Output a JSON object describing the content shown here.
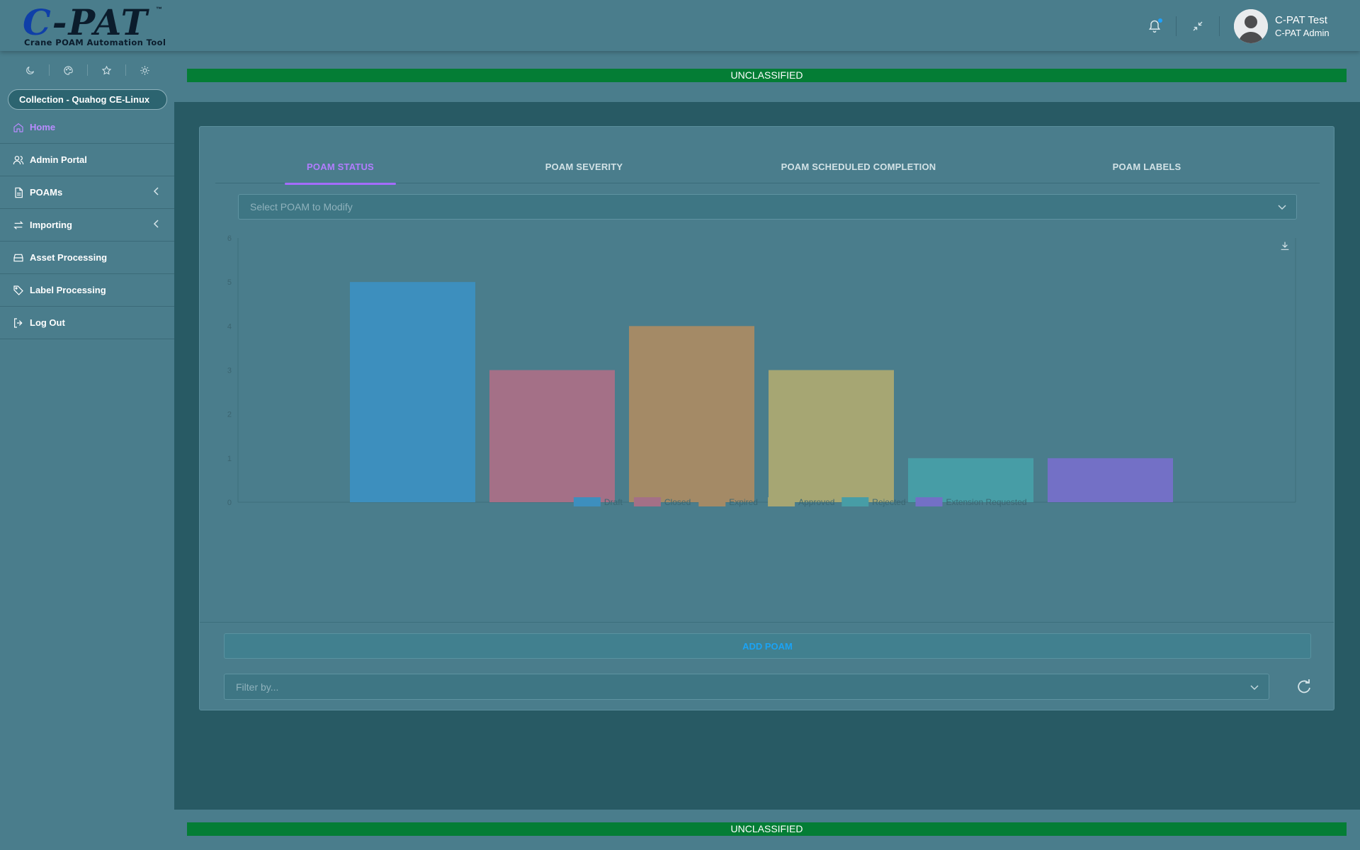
{
  "app": {
    "logo_text": "C-PAT",
    "logo_tm": "™",
    "logo_subtitle": "Crane POAM Automation Tool"
  },
  "user": {
    "name": "C-PAT Test",
    "role": "C-PAT Admin"
  },
  "classification": {
    "top": "UNCLASSIFIED",
    "bottom": "UNCLASSIFIED",
    "color": "#047d35"
  },
  "sidebar": {
    "collection": "Collection - Quahog CE-Linux",
    "items": [
      {
        "label": "Home",
        "icon": "home-icon",
        "active": true
      },
      {
        "label": "Admin Portal",
        "icon": "users-icon"
      },
      {
        "label": "POAMs",
        "icon": "file-icon",
        "expandable": true
      },
      {
        "label": "Importing",
        "icon": "arrows-exchange-icon",
        "expandable": true
      },
      {
        "label": "Asset Processing",
        "icon": "server-icon"
      },
      {
        "label": "Label Processing",
        "icon": "tag-icon"
      },
      {
        "label": "Log Out",
        "icon": "sign-out-icon"
      }
    ]
  },
  "tabs": [
    {
      "label": "POAM STATUS",
      "active": true
    },
    {
      "label": "POAM SEVERITY"
    },
    {
      "label": "POAM SCHEDULED COMPLETION"
    },
    {
      "label": "POAM LABELS"
    }
  ],
  "poam_select": {
    "placeholder": "Select POAM to Modify"
  },
  "filter_select": {
    "placeholder": "Filter by..."
  },
  "add_poam_label": "ADD POAM",
  "colors": {
    "accent": "#a56cff",
    "background": "#285a64",
    "panel": "#4a7d8c",
    "link": "#1ba3f5"
  },
  "chart_data": {
    "type": "bar",
    "categories": [
      "Draft",
      "Closed",
      "Expired",
      "Approved",
      "Rejected",
      "Extension Requested"
    ],
    "values": [
      5,
      3,
      4,
      3,
      1,
      1
    ],
    "colors": [
      "#3d8fbe",
      "#a47087",
      "#a48a66",
      "#a6a673",
      "#479da6",
      "#7370c6"
    ],
    "ylim": [
      0,
      6
    ],
    "yticks": [
      "0",
      "1",
      "2",
      "3",
      "4",
      "5",
      "6"
    ],
    "legend": [
      "Draft",
      "Closed",
      "Expired",
      "Approved",
      "Rejected",
      "Extension Requested"
    ],
    "legend_position": "bottom"
  }
}
